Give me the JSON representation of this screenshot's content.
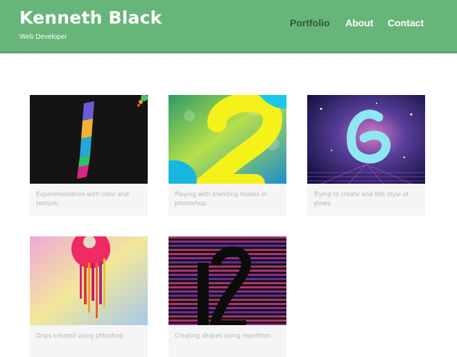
{
  "header": {
    "name": "Kenneth Black",
    "tagline": "Web Developer",
    "background_color": "#68b57a",
    "active_nav_color": "#2f5a3a"
  },
  "nav": {
    "portfolio": "Portfolio",
    "about": "About",
    "contact": "Contact",
    "active": "Portfolio"
  },
  "portfolio": {
    "items": [
      {
        "image": "number-1-color-stripes",
        "caption": "Experimentation with color and texture."
      },
      {
        "image": "number-2-blended-gradient",
        "caption": "Playing with blending modes in photoshop."
      },
      {
        "image": "number-6-80s-glow",
        "caption": "Trying to create and 80s style of glows."
      },
      {
        "image": "number-9-drips",
        "caption": "Drips created using phtoshop"
      },
      {
        "image": "number-12-stripes",
        "caption": "Creating shapes using repetition."
      }
    ]
  }
}
